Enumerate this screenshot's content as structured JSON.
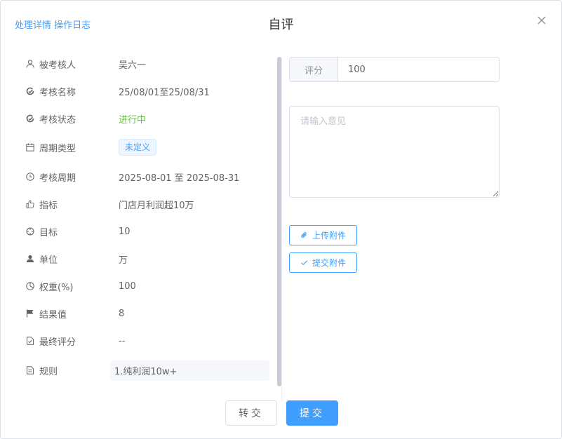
{
  "header": {
    "link_detail": "处理详情",
    "link_log": "操作日志",
    "title": "自评"
  },
  "info": [
    {
      "icon": "user-icon",
      "label": "被考核人",
      "value": "吴六一"
    },
    {
      "icon": "assessment-icon",
      "label": "考核名称",
      "value": "25/08/01至25/08/31"
    },
    {
      "icon": "status-icon",
      "label": "考核状态",
      "value": "进行中"
    },
    {
      "icon": "calendar-icon",
      "label": "周期类型",
      "value": "未定义"
    },
    {
      "icon": "clock-icon",
      "label": "考核周期",
      "value": "2025-08-01 至 2025-08-31"
    },
    {
      "icon": "thumb-icon",
      "label": "指标",
      "value": "门店月利润超10万"
    },
    {
      "icon": "target-icon",
      "label": "目标",
      "value": "10"
    },
    {
      "icon": "unit-icon",
      "label": "单位",
      "value": "万"
    },
    {
      "icon": "pie-icon",
      "label": "权重(%)",
      "value": "100"
    },
    {
      "icon": "flag-icon",
      "label": "结果值",
      "value": "8"
    },
    {
      "icon": "final-score-icon",
      "label": "最终评分",
      "value": "--"
    },
    {
      "icon": "document-icon",
      "label": "规则",
      "value": "1.纯利润10w+"
    }
  ],
  "form": {
    "score_label": "评分",
    "score_value": "100",
    "opinion_placeholder": "请输入意见",
    "upload_label": "上传附件",
    "submit_attach_label": "提交附件"
  },
  "footer": {
    "transfer_label": "转交",
    "submit_label": "提交"
  },
  "colors": {
    "primary": "#409eff",
    "success": "#67c23a",
    "text": "#606266"
  }
}
